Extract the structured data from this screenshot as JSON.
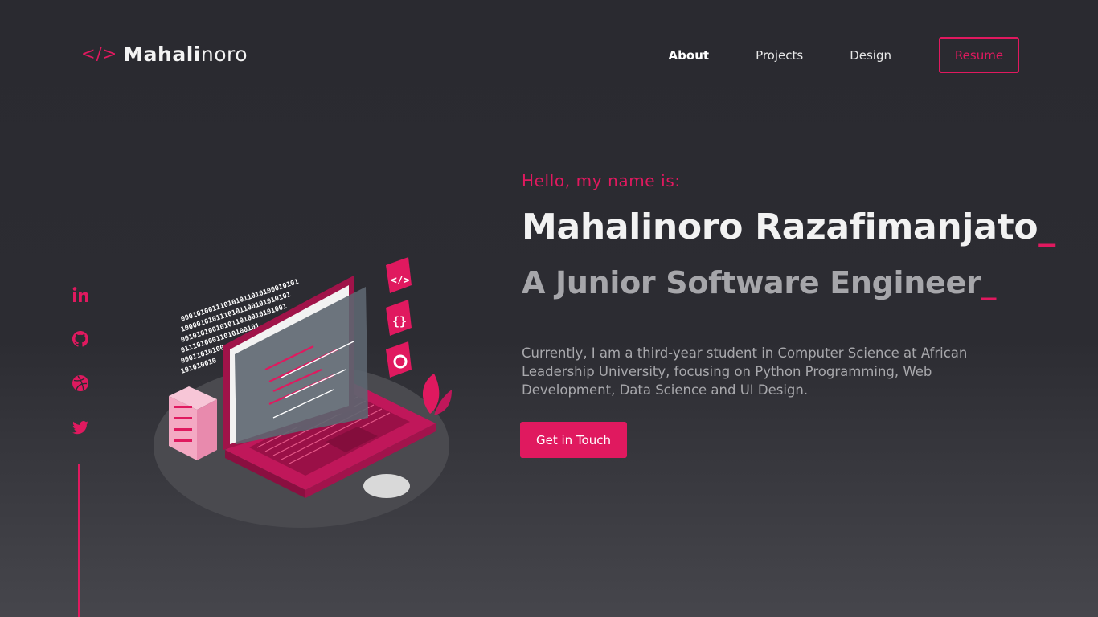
{
  "header": {
    "logo": {
      "code": "</>",
      "bold": "Mahali",
      "light": "noro"
    },
    "nav": [
      {
        "label": "About",
        "active": true
      },
      {
        "label": "Projects",
        "active": false
      },
      {
        "label": "Design",
        "active": false
      }
    ],
    "resume_label": "Resume"
  },
  "social": {
    "icons": [
      "linkedin-icon",
      "github-icon",
      "dribbble-icon",
      "twitter-icon"
    ]
  },
  "hero": {
    "greeting": "Hello, my name is:",
    "name": "Mahalinoro Razafimanjato",
    "role": "A Junior Software Engineer",
    "cursor": "_",
    "bio": "Currently, I am a third-year student in Computer Science at African Leadership University, focusing on Python Programming, Web Development, Data Science and UI Design.",
    "cta_label": "Get in Touch"
  },
  "illustration": {
    "binary_lines": [
      "000101001110101011010100010101",
      "1000010101110101100101010101",
      "001010100101011010010101001",
      "01110100011010100101",
      "00011010100",
      "101010010",
      "10101001"
    ]
  },
  "colors": {
    "accent": "#e0195f",
    "background": "#2c2c32",
    "text": "#f2f2f2",
    "muted": "#a6a6aa"
  }
}
